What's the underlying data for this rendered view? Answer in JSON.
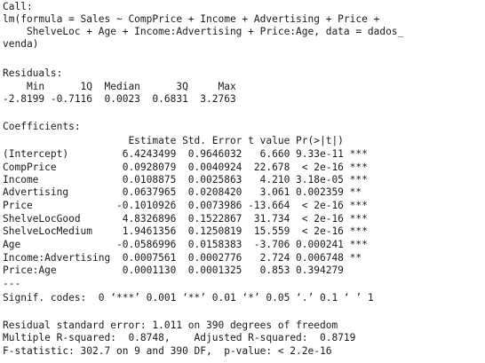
{
  "output": {
    "call_label": "Call:",
    "call_lines": [
      "lm(formula = Sales ~ CompPrice + Income + Advertising + Price +",
      "    ShelveLoc + Age + Income:Advertising + Price:Age, data = dados_",
      "venda)"
    ],
    "residuals_label": "Residuals:",
    "residuals_header": "    Min      1Q  Median      3Q     Max ",
    "residuals_values": "-2.8199 -0.7116  0.0023  0.6831  3.2763 ",
    "coefficients_label": "Coefficients:",
    "coef_header": "                     Estimate Std. Error t value Pr(>|t|)    ",
    "coef_rows": [
      "(Intercept)         6.4243499  0.9646032   6.660 9.33e-11 ***",
      "CompPrice           0.0928079  0.0040924  22.678  < 2e-16 ***",
      "Income              0.0108875  0.0025863   4.210 3.18e-05 ***",
      "Advertising         0.0637965  0.0208420   3.061 0.002359 ** ",
      "Price              -0.1010926  0.0073986 -13.664  < 2e-16 ***",
      "ShelveLocGood       4.8326896  0.1522867  31.734  < 2e-16 ***",
      "ShelveLocMedium     1.9461356  0.1250819  15.559  < 2e-16 ***",
      "Age                -0.0586996  0.0158383  -3.706 0.000241 ***",
      "Income:Advertising  0.0007561  0.0002776   2.724 0.006748 ** ",
      "Price:Age           0.0001130  0.0001325   0.853 0.394279    "
    ],
    "separator": "---",
    "signif_codes": "Signif. codes:  0 ‘***’ 0.001 ‘**’ 0.01 ‘*’ 0.05 ‘.’ 0.1 ‘ ’ 1",
    "residual_se": "Residual standard error: 1.011 on 390 degrees of freedom",
    "r_squared": "Multiple R-squared:  0.8748,\tAdjusted R-squared:  0.8719 ",
    "f_statistic": "F-statistic: 302.7 on 9 and 390 DF,  p-value: < 2.2e-16"
  }
}
